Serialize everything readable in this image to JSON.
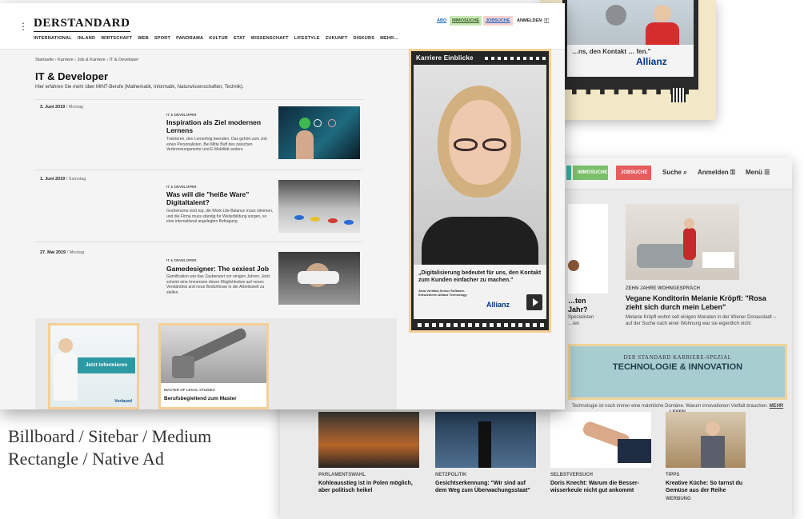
{
  "caption": {
    "line1": "Billboard / Sitebar / Medium",
    "line2": "Rectangle / Native Ad"
  },
  "ad_sheet": {
    "quote": "…ns, den Kontakt … fen.\"",
    "brand": "Allianz"
  },
  "back_page": {
    "immo_label": "IMMOSUCHE",
    "jobs_label": "JOBSUCHE",
    "search_label": "Suche",
    "login_label": "Anmelden",
    "menu_label": "Menü",
    "card1_partial_title": "…ten Jahr?",
    "card1_partial_teaser": "…n. Spezialisten …ten",
    "card2_kicker": "ZEHN JAHRE WOHNGESPRÄCH",
    "card2_title": "Vegane Konditorin Melanie Kröpfl: \"Rosa zieht sich durch mein Leben\"",
    "card2_teaser": "Melanie Kröpfl wohnt seit einigen Monaten in der Wiener Donaustadt – auf der Suche nach einer Wohnung war sie eigentlich nicht",
    "spezial_kicker": "DER STANDARD KARRIERE-SPEZIAL",
    "spezial_title": "TECHNOLOGIE & INNOVATION",
    "spezial_text": "Technologie ist noch immer eine männliche Domäne. Warum innovationen Vielfalt brauchen.",
    "spezial_link": "MEHR LESEN",
    "bottom_cards": [
      {
        "kicker": "PARLAMENTSWAHL",
        "title": "Kohleausstieg ist in Polen möglich, aber politisch heikel"
      },
      {
        "kicker": "NETZPOLITIK",
        "title": "Gesichtserkennung: \"Wir sind auf dem Weg zum Überwachungsstaat\""
      },
      {
        "kicker": "SELBSTVERSUCH",
        "title": "Doris Knecht: Warum die Besser-wisserkeule nicht gut ankommt"
      },
      {
        "kicker": "TIPPS",
        "title": "Kreative Küche: So tarnst du Gemüse aus der Reihe",
        "extra": "WERBUNG"
      }
    ]
  },
  "front_page": {
    "logo": "DERSTANDARD",
    "nav": [
      "INTERNATIONAL",
      "INLAND",
      "WIRTSCHAFT",
      "WEB",
      "SPORT",
      "PANORAMA",
      "KULTUR",
      "ETAT",
      "WISSENSCHAFT",
      "LIFESTYLE",
      "ZUKUNFT",
      "DISKURS",
      "MEHR…"
    ],
    "abo_label": "ABO",
    "immo_label": "IMMOSUCHE",
    "jobs_label": "JOBSUCHE",
    "login_label": "ANMELDEN",
    "breadcrumb": "Startseite › Karriere › Job & Karriere › IT & Developer",
    "page_title": "IT & Developer",
    "page_subtitle": "Hier erfahren Sie mehr über MINT-Berufe (Mathematik, Informatik, Naturwissenschaften, Technik).",
    "articles": [
      {
        "date": "3. Juni 2019",
        "weekday": "/ Montag",
        "kicker": "IT & DEVELOPER",
        "title": "Inspiration als Ziel modernen Lernens",
        "teaser": "Trainieren, den Lernerfolg beenden. Das gehört zum Job eines Personalisten. Bei Mitte Buft des zwischen Verbrennungsmotor und E-Mobilität andere"
      },
      {
        "date": "1. Juni 2019",
        "weekday": "/ Samstag",
        "kicker": "IT & DEVELOPER",
        "title": "Was will die \"heiße Ware\" Digitaltalent?",
        "teaser": "Großeinsme sind top, die Work-Life-Balance muss stimmen, und die Firma muss ständig für Weiterbildung sorgen, so eine international angelegten Befragung"
      },
      {
        "date": "27. Mai 2019",
        "weekday": "/ Montag",
        "kicker": "IT & DEVELOPER",
        "title": "Gamedesigner: The sexiest Job",
        "teaser": "Gamification war das Zauberwort vor einigen Jahren. Jetzt scheint eine Immersion dieser Möglichkeiten auf neues Verständnis und neue Bedürfnisse in der Arbeitswelt zu stellen."
      }
    ],
    "rect_ad": {
      "cta": "Jetzt informieren",
      "brand": "Verbund"
    },
    "native_ad": {
      "kicker": "MASTER OF LEGAL STUDIES",
      "title": "Berufsbegleitend zum Master"
    },
    "sitebar": {
      "title": "Karriere Einblicke",
      "quote": "„Digitalisierung bedeutet für uns, den Kontakt zum Kunden einfacher zu machen.\"",
      "person": "Jana Vertikka Senior Software-Entwicklerin Allianz Technology",
      "brand": "Allianz"
    }
  }
}
